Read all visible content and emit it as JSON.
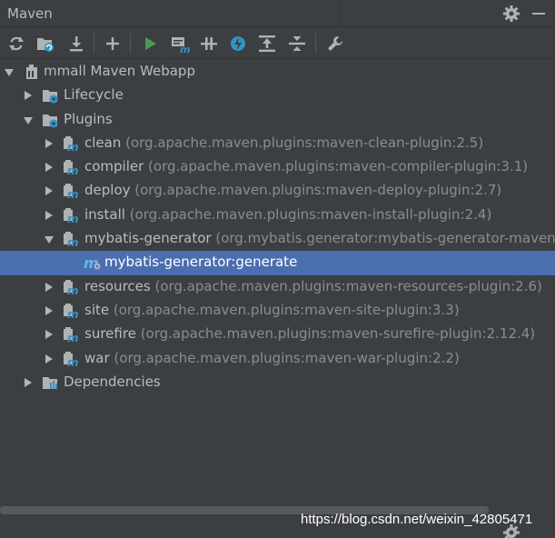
{
  "window": {
    "title": "Maven"
  },
  "toolbar": {
    "icons": [
      "refresh-icon",
      "reimport-folder-icon",
      "download-icon",
      "add-icon",
      "run-icon",
      "execute-goal-icon",
      "toggle-offline-icon",
      "skip-tests-icon",
      "show-dependencies-icon",
      "collapse-all-icon",
      "settings-wrench-icon"
    ]
  },
  "tree": {
    "project": "mmall Maven Webapp",
    "lifecycle": "Lifecycle",
    "plugins": "Plugins",
    "plugin_items": [
      {
        "name": "clean",
        "coord": "(org.apache.maven.plugins:maven-clean-plugin:2.5)"
      },
      {
        "name": "compiler",
        "coord": "(org.apache.maven.plugins:maven-compiler-plugin:3.1)"
      },
      {
        "name": "deploy",
        "coord": "(org.apache.maven.plugins:maven-deploy-plugin:2.7)"
      },
      {
        "name": "install",
        "coord": "(org.apache.maven.plugins:maven-install-plugin:2.4)"
      },
      {
        "name": "mybatis-generator",
        "coord": "(org.mybatis.generator:mybatis-generator-maven-p"
      },
      {
        "name": "resources",
        "coord": "(org.apache.maven.plugins:maven-resources-plugin:2.6)"
      },
      {
        "name": "site",
        "coord": "(org.apache.maven.plugins:maven-site-plugin:3.3)"
      },
      {
        "name": "surefire",
        "coord": "(org.apache.maven.plugins:maven-surefire-plugin:2.12.4)"
      },
      {
        "name": "war",
        "coord": "(org.apache.maven.plugins:maven-war-plugin:2.2)"
      }
    ],
    "goal": "mybatis-generator:generate",
    "dependencies": "Dependencies"
  },
  "watermark": "https://blog.csdn.net/weixin_42805471",
  "colors": {
    "background": "#3c3f41",
    "selection": "#4b6eaf",
    "text": "#bbbbbb",
    "secondary_text": "#8c8c8c",
    "run_green": "#499c54",
    "accent_blue": "#3592c4"
  }
}
